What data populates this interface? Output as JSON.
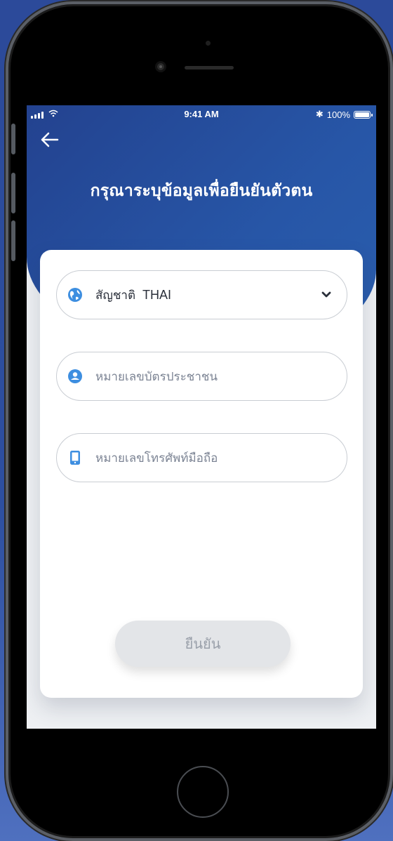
{
  "status_bar": {
    "time": "9:41 AM",
    "battery": "100%",
    "bluetooth_symbol": "✱"
  },
  "header": {
    "title": "กรุณาระบุข้อมูลเพื่อยืนยันตัวตน",
    "back_icon": "arrow-left-icon"
  },
  "form": {
    "nationality": {
      "label": "สัญชาติ",
      "value": "THAI",
      "icon": "globe-icon"
    },
    "id_card": {
      "placeholder": "หมายเลขบัตรประชาชน",
      "icon": "person-circle-icon"
    },
    "phone": {
      "placeholder": "หมายเลขโทรศัพท์มือถือ",
      "icon": "mobile-phone-icon"
    },
    "confirm_label": "ยืนยัน"
  },
  "colors": {
    "brand_blue": "#2756a7",
    "icon_blue": "#3d8ee0",
    "button_disabled": "#e3e5e8"
  }
}
